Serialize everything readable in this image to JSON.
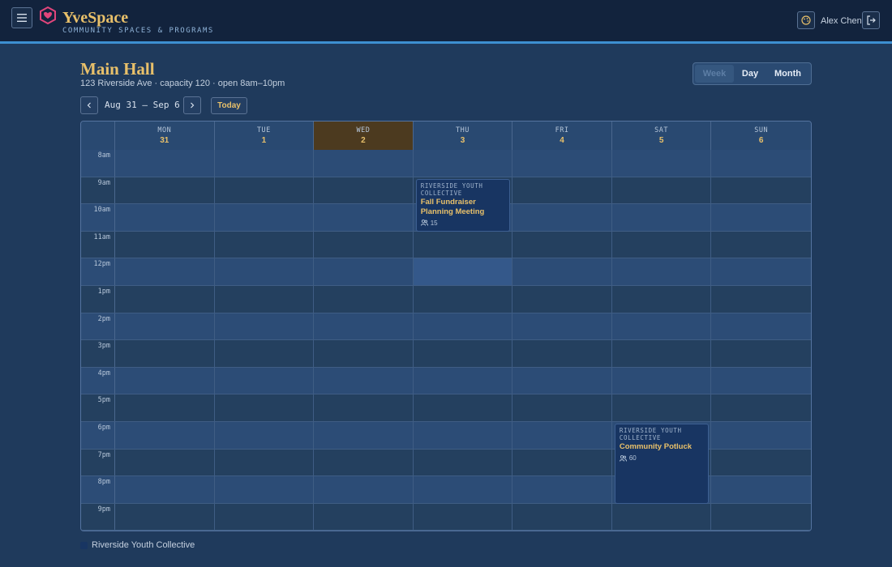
{
  "header": {
    "brand_name": "YveSpace",
    "brand_tagline": "COMMUNITY SPACES & PROGRAMS",
    "user_name": "Alex Chen"
  },
  "room": {
    "title": "Main Hall",
    "subtitle": "123 Riverside Ave · capacity 120 · open 8am–10pm"
  },
  "views": {
    "week": "Week",
    "day": "Day",
    "month": "Month",
    "active": "week"
  },
  "navigation": {
    "range_label": "Aug 31 – Sep 6",
    "today_label": "Today"
  },
  "calendar": {
    "days": [
      {
        "name": "MON",
        "num": "31"
      },
      {
        "name": "TUE",
        "num": "1"
      },
      {
        "name": "WED",
        "num": "2",
        "today": true
      },
      {
        "name": "THU",
        "num": "3"
      },
      {
        "name": "FRI",
        "num": "4"
      },
      {
        "name": "SAT",
        "num": "5"
      },
      {
        "name": "SUN",
        "num": "6"
      }
    ],
    "hours": [
      "8am",
      "9am",
      "10am",
      "11am",
      "12pm",
      "1pm",
      "2pm",
      "3pm",
      "4pm",
      "5pm",
      "6pm",
      "7pm",
      "8pm",
      "9pm"
    ],
    "events": [
      {
        "org": "Riverside Youth Collective",
        "title": "Fall Fundraiser Planning Meeting",
        "attendees": "15",
        "day": "THU",
        "start": "9am",
        "end": "11am"
      },
      {
        "org": "Riverside Youth Collective",
        "title": "Community Potluck",
        "attendees": "60",
        "day": "SAT",
        "start": "6pm",
        "end": "9pm"
      }
    ]
  },
  "legend": {
    "label": "Riverside Youth Collective"
  },
  "colors": {
    "accent": "#e8c06a",
    "event_bg": "#183562",
    "today_bg": "#4c3a1f",
    "header_border": "#3d8fd1"
  }
}
